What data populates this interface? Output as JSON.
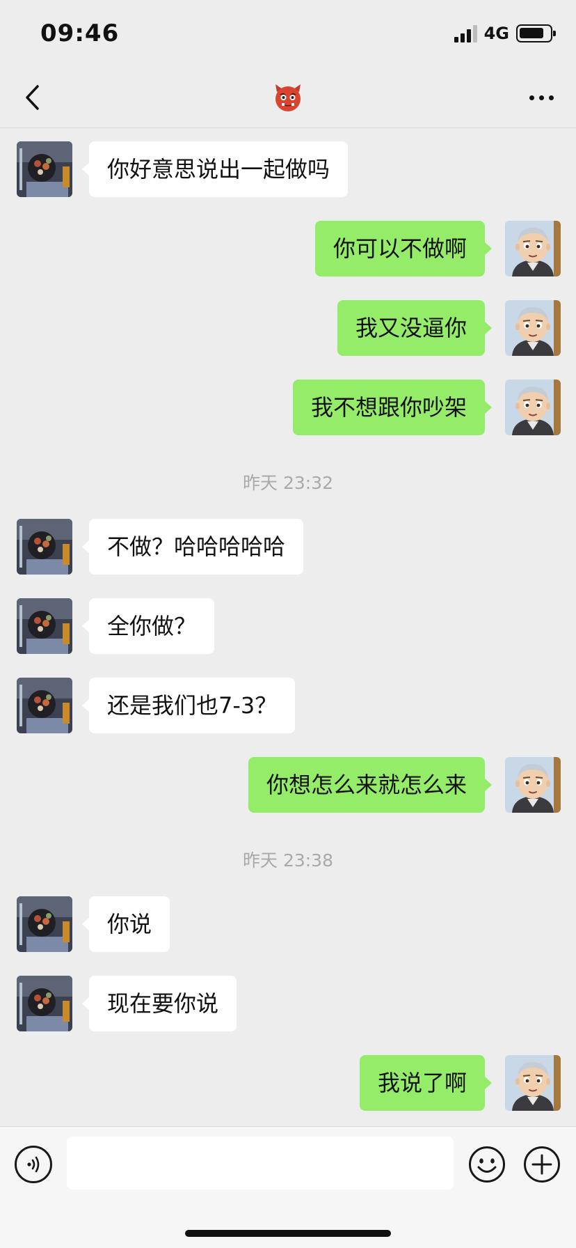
{
  "status_bar": {
    "time": "09:46",
    "network": "4G"
  },
  "nav": {
    "title_icon": "red-ogre-emoji-icon",
    "back_icon": "chevron-left-icon",
    "more_icon": "more-dots-icon"
  },
  "messages": [
    {
      "side": "left",
      "text": "你好意思说出一起做吗"
    },
    {
      "side": "right",
      "text": "你可以不做啊"
    },
    {
      "side": "right",
      "text": "我又没逼你"
    },
    {
      "side": "right",
      "text": "我不想跟你吵架"
    },
    {
      "type": "time",
      "text": "昨天 23:32"
    },
    {
      "side": "left",
      "text": "不做？哈哈哈哈哈"
    },
    {
      "side": "left",
      "text": "全你做？"
    },
    {
      "side": "left",
      "text": "还是我们也7-3？"
    },
    {
      "side": "right",
      "text": "你想怎么来就怎么来"
    },
    {
      "type": "time",
      "text": "昨天 23:38"
    },
    {
      "side": "left",
      "text": "你说"
    },
    {
      "side": "left",
      "text": "现在要你说"
    },
    {
      "side": "right",
      "text": "我说了啊"
    }
  ],
  "input_bar": {
    "value": "",
    "placeholder": ""
  },
  "colors": {
    "background": "#ededed",
    "self_bubble": "#95ec69",
    "other_bubble": "#ffffff",
    "timestamp": "#a9a9a9"
  }
}
